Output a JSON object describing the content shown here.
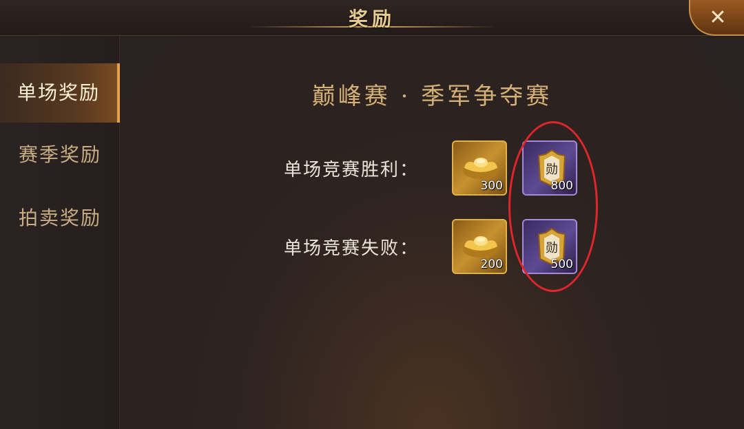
{
  "window": {
    "title": "奖励",
    "close_icon": "close-icon"
  },
  "sidebar": {
    "tabs": [
      {
        "label": "单场奖励",
        "active": true
      },
      {
        "label": "赛季奖励",
        "active": false
      },
      {
        "label": "拍卖奖励",
        "active": false
      }
    ]
  },
  "main": {
    "title": "巅峰赛 · 季军争夺赛",
    "rows": [
      {
        "label": "单场竞赛胜利：",
        "rewards": [
          {
            "icon": "gold-ingot-icon",
            "quantity": "300"
          },
          {
            "icon": "merit-token-icon",
            "token_char": "勋",
            "quantity": "800"
          }
        ]
      },
      {
        "label": "单场竞赛失败：",
        "rewards": [
          {
            "icon": "gold-ingot-icon",
            "quantity": "200"
          },
          {
            "icon": "merit-token-icon",
            "token_char": "勋",
            "quantity": "500"
          }
        ]
      }
    ]
  },
  "colors": {
    "accent_gold": "#e2a24f",
    "highlight_red": "#e0262c",
    "purple_frame": "#a48ad8"
  }
}
